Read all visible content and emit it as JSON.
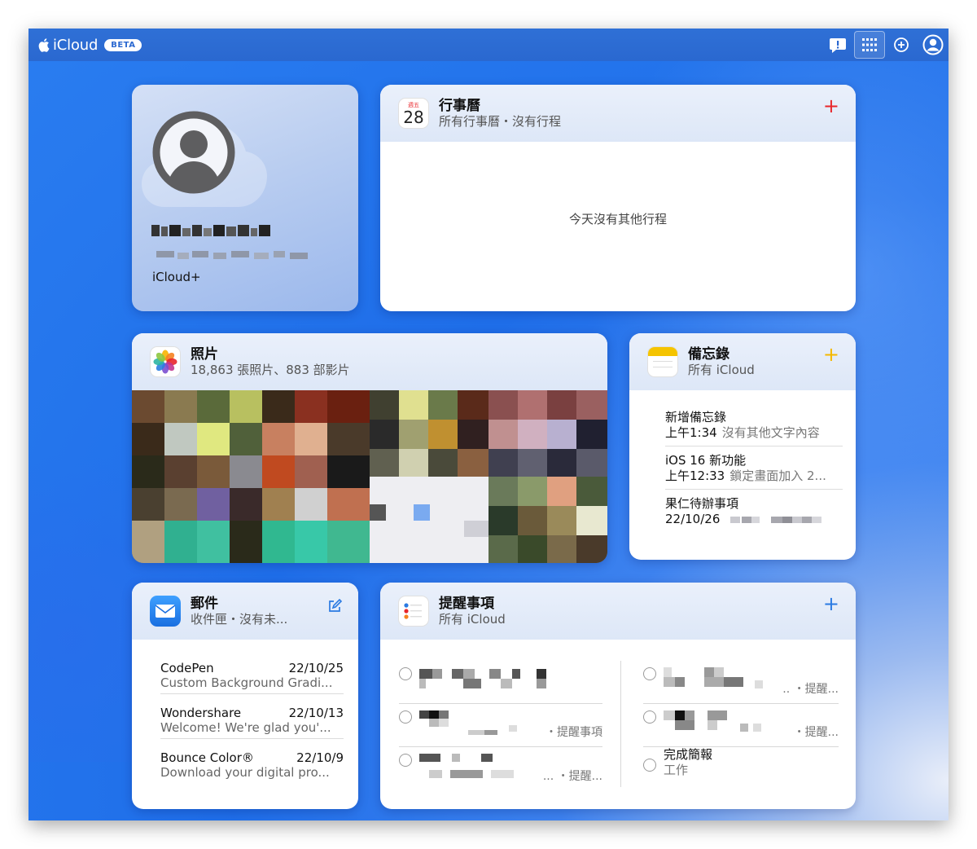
{
  "topbar": {
    "brand": "iCloud",
    "badge": "BETA",
    "icons": [
      "apple-icon",
      "feedback-icon",
      "app-grid-icon",
      "add-icon",
      "account-icon"
    ]
  },
  "profile": {
    "plan": "iCloud+"
  },
  "calendar": {
    "title": "行事曆",
    "subtitle": "所有行事曆・沒有行程",
    "icon_weekday": "週五",
    "icon_day": "28",
    "add_label": "+",
    "empty_message": "今天沒有其他行程",
    "accent": "#e8262b"
  },
  "photos": {
    "title": "照片",
    "subtitle": "18,863 張照片、883 部影片"
  },
  "notes": {
    "title": "備忘錄",
    "subtitle": "所有 iCloud",
    "add_label": "+",
    "accent": "#f5b800",
    "items": [
      {
        "title": "新增備忘錄",
        "time": "上午1:34",
        "preview": "沒有其他文字內容"
      },
      {
        "title": "iOS 16 新功能",
        "time": "上午12:33",
        "preview": "鎖定畫面加入 2..."
      },
      {
        "title": "果仁待辦事項",
        "time": "22/10/26",
        "preview": ""
      }
    ]
  },
  "mail": {
    "title": "郵件",
    "subtitle": "收件匣・沒有未...",
    "accent": "#2a7ae2",
    "items": [
      {
        "sender": "CodePen",
        "date": "22/10/25",
        "preview": "Custom Background Gradi..."
      },
      {
        "sender": "Wondershare",
        "date": "22/10/13",
        "preview": "Welcome! We're glad you'..."
      },
      {
        "sender": "Bounce Color®",
        "date": "22/10/9",
        "preview": "Download your digital pro..."
      }
    ]
  },
  "reminders": {
    "title": "提醒事項",
    "subtitle": "所有 iCloud",
    "add_label": "+",
    "accent": "#2a7ae2",
    "left": [
      {
        "list": ""
      },
      {
        "list": "・提醒事項"
      },
      {
        "list": "... ・提醒..."
      }
    ],
    "right": [
      {
        "list": ".. ・提醒..."
      },
      {
        "list": "・提醒..."
      },
      {
        "title": "完成簡報",
        "list": "工作"
      }
    ]
  }
}
